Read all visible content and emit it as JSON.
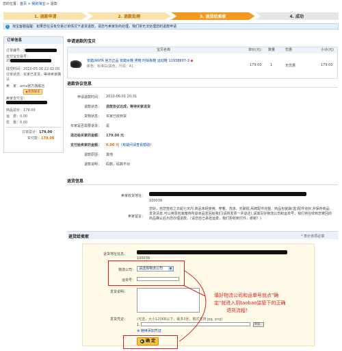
{
  "breadcrumb": {
    "prefix": "您的位置：",
    "home": "首页",
    "sep1": " > ",
    "mytaobao": "我的淘宝",
    "sep2": " > ",
    "current": "退款"
  },
  "steps": [
    "1. 退款申请",
    "2. 退款处理",
    "3. 退货给卖家",
    "4. 成功"
  ],
  "notice": "淘宝客服提醒：如果您在没有交易订单情况下退货退款，请您与卖家协商处理，我们将无法处理您的退款申请",
  "order_info": {
    "title": "订单信息",
    "order_no_label": "订单编号：3",
    "alipay_label": "支付宝交易号：",
    "alipay_prefix": "20",
    "time_label": "成交时间：",
    "time_value": "2010-05-30 22:02:05",
    "status_label": "订单状态：",
    "status_value": "买家已发货，等待卖家确认",
    "seller_label": "卖　家：",
    "seller_value": "anta官方旗舰店",
    "wangwang": "和我联系",
    "alipay2_label": "卖家支付宝：",
    "goods_label": "商品总价：",
    "goods_value": "179.00",
    "ship_label": "运　费：",
    "ship_value": "0.00",
    "discount_label": "优　惠：",
    "discount_value": "0.00",
    "total_label": "订单总计：",
    "total_value": "179.00",
    "paid_label": "实付款：",
    "paid_value": "179.00"
  },
  "product": {
    "section": "申请退款的宝贝",
    "headers": [
      "宝贝名称",
      "单价(元)",
      "数量",
      "优惠",
      "小计(元)"
    ],
    "name": "安踏/ANTA 官方正品 安踏女鞋 男鞋",
    "name2": "时尚板鞋 运动鞋 11938607-3",
    "attrs": "颜色：标准白/黑色；尺码：41",
    "price": "179.00",
    "qty": "1",
    "discount": "无优惠",
    "subtotal": "179.00"
  },
  "agreement": {
    "section": "退款协议信息",
    "rows": [
      {
        "label": "申请退款时间：",
        "value": "2010-06-01 20:31"
      },
      {
        "label": "退款状态：",
        "value": "退款协议达成，等待买家退货"
      },
      {
        "label": "货物状态：",
        "value": "买家已收到货"
      },
      {
        "label": "买家是否需要退货：",
        "value": "是"
      },
      {
        "label": "退还给买家的金额：",
        "value": "179.00 元"
      },
      {
        "label": "支付给卖家的金额：",
        "value": "0.00 元",
        "extra": "（有疑问请查看帮助）"
      },
      {
        "label": "退款原因：",
        "value": "其他"
      },
      {
        "label": "退款说明：",
        "value": "码数，码数不对"
      }
    ]
  },
  "return_info": {
    "section": "退货信息",
    "addr_label": "卖家收货地址：",
    "zip": "100039",
    "msg_label": "卖家留言：",
    "msg": "您好，自您签收之日起七天内,商品未经使用、穿着、洗涤、无破损,吊牌配件完整、商品包装袋(盒)配件完好,并保存商品发货清单,可以用原包装箱将所退商品发回给我们(请将发票一并退还),请填写好物流公司和运单号，我们将在收到您寄回的商品确认后为您办理退款。(请您自己承担运费，我们拒收到付件，谢谢！)"
  },
  "return_form": {
    "section": "退货给卖家",
    "required": "* 表示该项必填",
    "addr_label": "退货地址信息：",
    "zip": "100039",
    "logistics_label": "物流公司：",
    "logistics_value": "请选择物流公司",
    "waybill_label": "运单号：",
    "desc_label": "发货说明：",
    "proof_label": "发货凭证：",
    "proof_hint": "(可选，大小120KB以下，最多3张，格式支持 jpg, png)",
    "file_index": "1.",
    "browse": "浏览...",
    "add_more": "继续添加凭证",
    "confirm": "确 定"
  },
  "annotation": {
    "line1": "填好物流公司和运单号就点\"确",
    "line2": "定\"就进入到taobao监管下的正确",
    "line3": "退货流程！"
  }
}
